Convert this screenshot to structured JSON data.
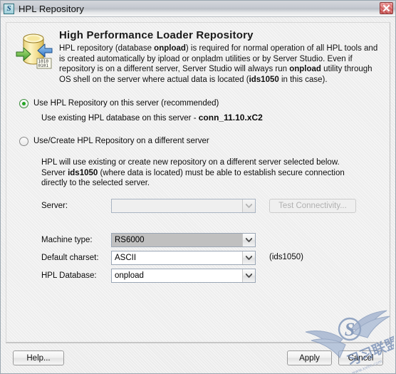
{
  "window": {
    "title": "HPL Repository",
    "app_icon": "server-studio-s-icon",
    "close_icon": "close-icon"
  },
  "header": {
    "icon": "database-repository-icon",
    "title": "High Performance Loader Repository",
    "description_parts": [
      {
        "text": "HPL repository (database ",
        "bold": false
      },
      {
        "text": "onpload",
        "bold": true
      },
      {
        "text": ") is required for normal operation of all HPL tools and is created automatically by ipload or onpladm utilities or by Server Studio. Even if repository is on a different server, Server Studio will always run ",
        "bold": false
      },
      {
        "text": "onpload",
        "bold": true
      },
      {
        "text": " utility through OS shell on the server where actual data is located (",
        "bold": false
      },
      {
        "text": "ids1050",
        "bold": true
      },
      {
        "text": " in this case).",
        "bold": false
      }
    ],
    "description_plain": "HPL repository (database onpload) is required for normal operation of all HPL tools and is created automatically by ipload or onpladm utilities or by Server Studio. Even if repository is on a different server, Server Studio will always run onpload utility through OS shell on the server where actual data is located (ids1050 in this case)."
  },
  "options": {
    "radio_this_server": {
      "label": "Use HPL Repository on this server (recommended)",
      "selected": true
    },
    "existing_db_prefix": "Use existing HPL database on this server - ",
    "existing_db_name": "conn_11.10.xC2",
    "radio_different_server": {
      "label": "Use/Create HPL Repository on a different server",
      "selected": false
    },
    "different_server_desc_parts": [
      {
        "text": "HPL will use existing or create new repository on a different server selected below. Server ",
        "bold": false
      },
      {
        "text": "ids1050",
        "bold": true
      },
      {
        "text": " (where data is located) must be able to establish secure connection directly to the selected server.",
        "bold": false
      }
    ],
    "different_server_desc_plain": "HPL will use existing or create new repository on a different server selected below. Server ids1050 (where data is located) must be able to establish secure connection directly to the selected server."
  },
  "server_row": {
    "label": "Server:",
    "value": "",
    "placeholder": "",
    "disabled": true,
    "dropdown_icon": "chevron-down-icon",
    "test_connectivity_label": "Test Connectivity...",
    "test_connectivity_disabled": true
  },
  "form": {
    "machine_type": {
      "label": "Machine type:",
      "value": "RS6000",
      "dropdown_icon": "chevron-down-icon"
    },
    "default_charset": {
      "label": "Default charset:",
      "value": "ASCII",
      "dropdown_icon": "chevron-down-icon"
    },
    "hpl_database": {
      "label": "HPL Database:",
      "value": "onpload",
      "dropdown_icon": "chevron-down-icon"
    },
    "server_note": "(ids1050)"
  },
  "footer": {
    "help_label": "Help...",
    "apply_label": "Apply",
    "cancel_label": "Cancel"
  },
  "watermark": {
    "text": "习习联盟",
    "sub_text": "www.xxlm.com",
    "logo": "winged-s-logo"
  },
  "colors": {
    "accent_radio": "#22a522",
    "titlebar": "#c6cad1",
    "close_button": "#d35b5b",
    "panel_bg": "#eeeeee",
    "combo_border": "#9aa6b5",
    "selected_field": "#c0c0c0"
  }
}
